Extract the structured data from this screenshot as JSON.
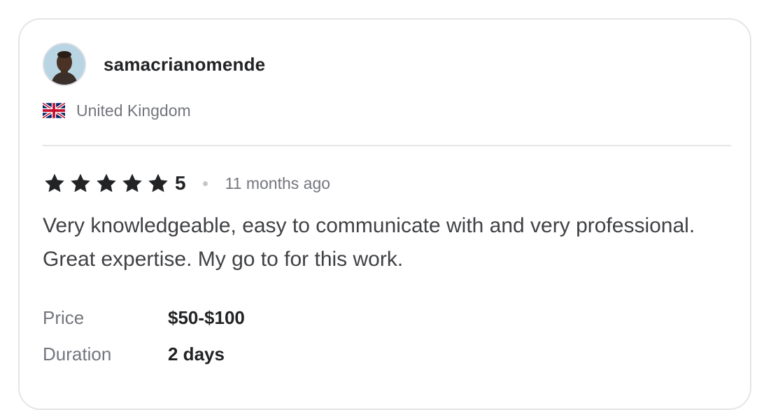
{
  "reviewer": {
    "username": "samacrianomende",
    "country": "United Kingdom",
    "avatar_icon": "user-avatar-photo",
    "flag_icon": "uk-flag-icon"
  },
  "rating": {
    "stars": 5,
    "max_stars": 5,
    "value": "5",
    "time_ago": "11 months ago",
    "star_color": "#222325"
  },
  "review": {
    "text": "Very knowledgeable, easy to communicate with and very professional. Great expertise. My go to for this work."
  },
  "details": [
    {
      "label": "Price",
      "value": "$50-$100"
    },
    {
      "label": "Duration",
      "value": "2 days"
    }
  ]
}
